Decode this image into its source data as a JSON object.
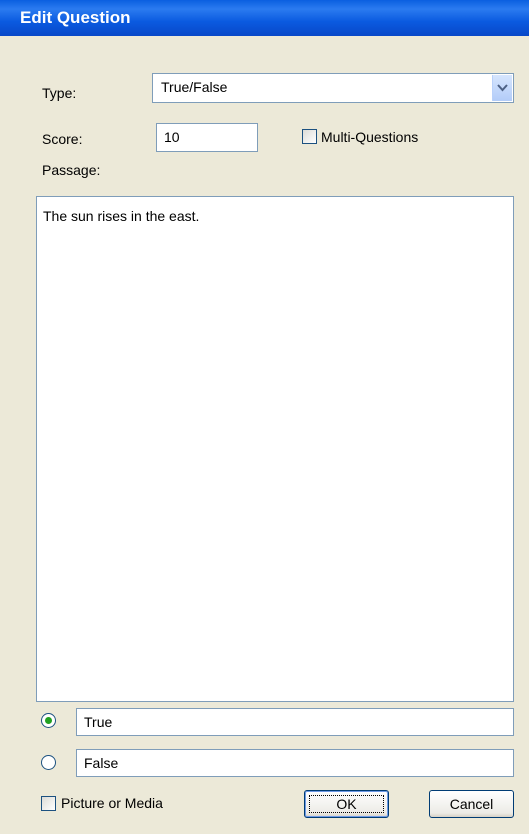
{
  "window": {
    "title": "Edit Question"
  },
  "type": {
    "label": "Type:",
    "value": "True/False"
  },
  "score": {
    "label": "Score:",
    "value": "10"
  },
  "multi_questions": {
    "label": "Multi-Questions",
    "checked": false
  },
  "passage": {
    "label": "Passage:",
    "text": "The sun rises in the east."
  },
  "answers": [
    {
      "text": "True",
      "selected": true
    },
    {
      "text": "False",
      "selected": false
    }
  ],
  "picture_or_media": {
    "label": "Picture or Media",
    "checked": false
  },
  "buttons": {
    "ok": "OK",
    "cancel": "Cancel"
  },
  "colors": {
    "titlebar": "#0A5FE0",
    "dialog_bg": "#ECE9D8",
    "radio_selected": "#21A121"
  }
}
